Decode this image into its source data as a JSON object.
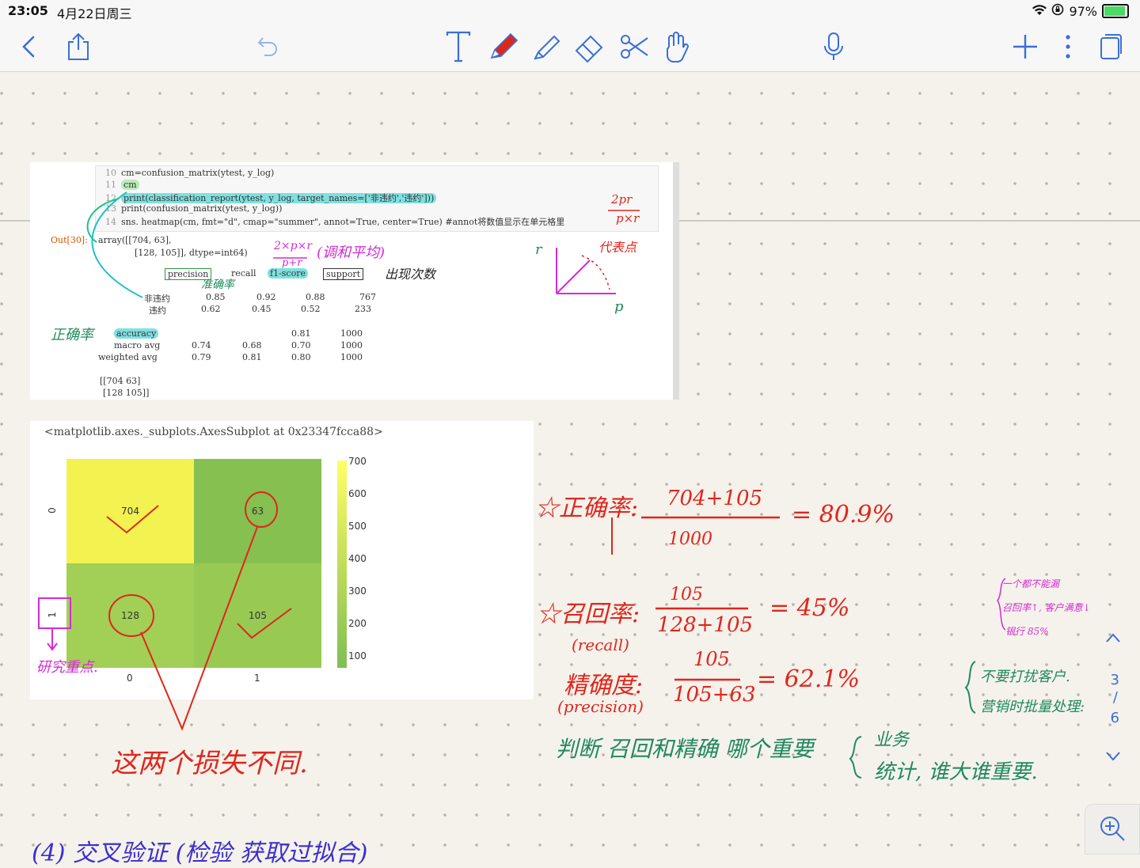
{
  "status": {
    "time": "23:05",
    "date": "4月22日周三",
    "battery": "97%"
  },
  "toolbar": {
    "back_icon": "chevron-left-icon",
    "share_icon": "share-icon",
    "undo_icon": "undo-icon",
    "tools": [
      "text-tool-icon",
      "pen-icon",
      "highlighter-icon",
      "eraser-icon",
      "scissors-icon",
      "hand-icon"
    ],
    "mic_icon": "microphone-icon",
    "add_icon": "plus-icon",
    "more_icon": "more-icon",
    "pages_icon": "pages-icon",
    "accent_color": "#3a6fd8"
  },
  "code": {
    "lines": [
      {
        "num": "10",
        "text": "cm=confusion_matrix(ytest, y_log)"
      },
      {
        "num": "11",
        "text": "cm"
      },
      {
        "num": "12",
        "text": "print(classification_report(ytest, y_log, target_names=['非违约','违约']))"
      },
      {
        "num": "13",
        "text": "print(confusion_matrix(ytest, y_log))"
      },
      {
        "num": "14",
        "text": "sns. heatmap(cm, fmt=\"d\", cmap=\"summer\", annot=True, center=True) #annot将数值显示在单元格里"
      }
    ],
    "out_label": "Out[30]:",
    "array_line1": "array([[704,  63],",
    "array_line2": "[128, 105]], dtype=int64)",
    "headers": [
      "precision",
      "recall",
      "f1-score",
      "support"
    ],
    "rows": [
      {
        "label": "非违约",
        "values": [
          "0.85",
          "0.92",
          "0.88",
          "767"
        ]
      },
      {
        "label": "违约",
        "values": [
          "0.62",
          "0.45",
          "0.52",
          "233"
        ]
      }
    ],
    "accuracy": {
      "label": "accuracy",
      "values": [
        "",
        "",
        "0.81",
        "1000"
      ]
    },
    "macro": {
      "label": "macro avg",
      "values": [
        "0.74",
        "0.68",
        "0.70",
        "1000"
      ]
    },
    "weighted": {
      "label": "weighted avg",
      "values": [
        "0.79",
        "0.81",
        "0.80",
        "1000"
      ]
    },
    "matrix1": "[[704  63]",
    "matrix2": "[128 105]]"
  },
  "plot": {
    "title": "<matplotlib.axes._subplots.AxesSubplot at 0x23347fcca88>",
    "cells": [
      "704",
      "63",
      "128",
      "105"
    ],
    "xticks": [
      "0",
      "1"
    ],
    "yticks": [
      "0",
      "1"
    ],
    "colorbar_ticks": [
      "700",
      "600",
      "500",
      "400",
      "300",
      "200",
      "100"
    ]
  },
  "notes": {
    "formula_f1": "2×p×r",
    "formula_f1_den": "p+r",
    "harmonic": "(调和平均)",
    "occurrence": "出现次数",
    "precision_note": "准确率",
    "accuracy_note": "正确率",
    "top_frac_num": "2pr",
    "top_frac_den": "p×r",
    "axis_r": "r",
    "axis_p": "p",
    "represent": "代表点",
    "accuracy_line": "☆正确率:",
    "acc_num": "704+105",
    "acc_den": "1000",
    "acc_result": "= 80.9%",
    "recall_line": "☆召回率:",
    "recall_en": "(recall)",
    "recall_num": "105",
    "recall_den": "128+105",
    "recall_result": "= 45%",
    "precision_line": "精确度:",
    "precision_en": "(precision)",
    "prec_num": "105",
    "prec_den": "105+63",
    "prec_result": "= 62.1%",
    "loss_note": "这两个损失不同.",
    "focus_note": "研究重点.",
    "judge_note": "判断 召回和精确 哪个重要",
    "business": "业务",
    "stats": "统计, 谁大谁重要.",
    "side1": "一个都不能漏",
    "side2": "召回率↑, 客户满意↓",
    "side3": "银行  85%",
    "side4": "不要打扰客户.",
    "side5": "营销时批量处理:",
    "bottom_partial": "(4) 交叉验证 (检验 获取过拟合)"
  },
  "pagenav": {
    "current": "3",
    "sep": "/",
    "total": "6"
  }
}
